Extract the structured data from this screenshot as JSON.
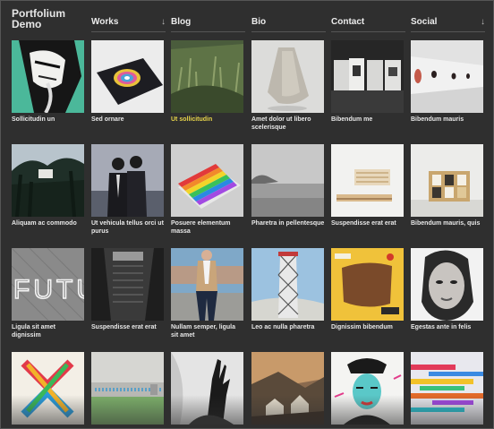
{
  "site": {
    "title_line1": "Portfolium",
    "title_line2": "Demo"
  },
  "nav": [
    {
      "label": "Works",
      "arrow": "↓"
    },
    {
      "label": "Blog",
      "arrow": ""
    },
    {
      "label": "Bio",
      "arrow": ""
    },
    {
      "label": "Contact",
      "arrow": ""
    },
    {
      "label": "Social",
      "arrow": "↓"
    }
  ],
  "items": [
    {
      "caption": "Sollicitudin un",
      "image": "stylized-face-portrait",
      "highlighted": false
    },
    {
      "caption": "Sed ornare",
      "image": "rainbow-disc-book",
      "highlighted": false
    },
    {
      "caption": "Ut sollicitudin",
      "image": "grass-field",
      "highlighted": true
    },
    {
      "caption": "Amet dolor ut libero scelerisque",
      "image": "paper-bag",
      "highlighted": false
    },
    {
      "caption": "Bibendum me",
      "image": "printed-cards",
      "highlighted": false
    },
    {
      "caption": "Bibendum mauris",
      "image": "white-gallery-room",
      "highlighted": false
    },
    {
      "caption": "Aliquam ac commodo",
      "image": "forest-house",
      "highlighted": false
    },
    {
      "caption": "Ut vehicula tellus orci ut purus",
      "image": "two-men-suits",
      "highlighted": false
    },
    {
      "caption": "Posuere elementum massa",
      "image": "rainbow-book",
      "highlighted": false
    },
    {
      "caption": "Pharetra in pellentesque",
      "image": "foggy-sea",
      "highlighted": false
    },
    {
      "caption": "Suspendisse erat erat",
      "image": "wooden-shelf",
      "highlighted": false
    },
    {
      "caption": "Bibendum mauris, quis",
      "image": "modular-shelves",
      "highlighted": false
    },
    {
      "caption": "Ligula sit amet dignissim",
      "image": "futu-typography",
      "highlighted": false
    },
    {
      "caption": "Suspendisse erat erat",
      "image": "dark-stairs",
      "highlighted": false
    },
    {
      "caption": "Nullam semper, ligula sit amet",
      "image": "man-sitting-wall",
      "highlighted": false
    },
    {
      "caption": "Leo ac nulla pharetra",
      "image": "lattice-tower",
      "highlighted": false
    },
    {
      "caption": "Dignissim bibendum",
      "image": "yellow-collage",
      "highlighted": false
    },
    {
      "caption": "Egestas ante in felis",
      "image": "woman-portrait",
      "highlighted": false
    },
    {
      "caption": "",
      "image": "colorful-x",
      "highlighted": false
    },
    {
      "caption": "",
      "image": "zipper-photo",
      "highlighted": false
    },
    {
      "caption": "",
      "image": "bw-hand",
      "highlighted": false
    },
    {
      "caption": "",
      "image": "landscape-painting",
      "highlighted": false
    },
    {
      "caption": "",
      "image": "pop-art-illustration",
      "highlighted": false
    },
    {
      "caption": "",
      "image": "glitch-colors",
      "highlighted": false
    }
  ],
  "colors": {
    "background": "#2f2f2f",
    "text": "#ececec",
    "highlight": "#e6d34a",
    "rule": "#555555"
  }
}
